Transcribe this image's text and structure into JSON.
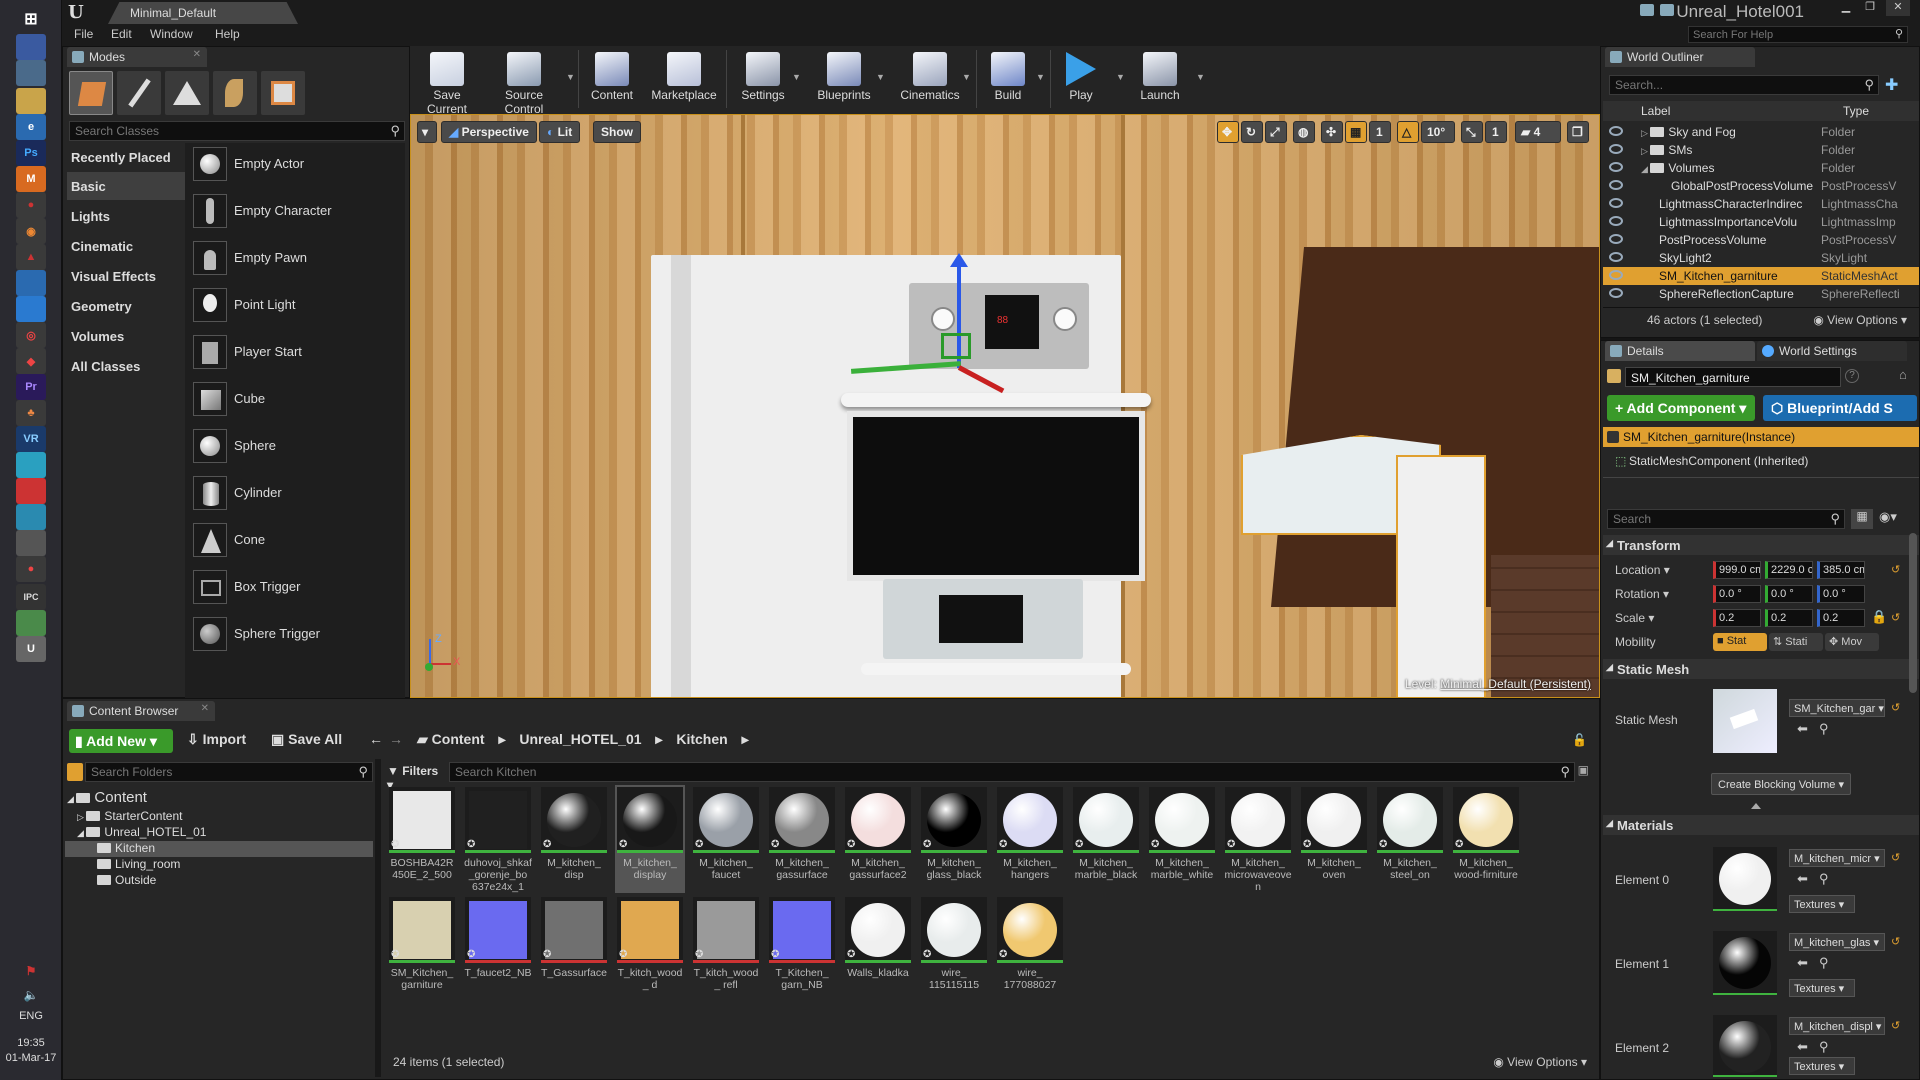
{
  "window": {
    "doc_tab": "Minimal_Default",
    "project_name": "Unreal_Hotel001",
    "help_search_placeholder": "Search For Help"
  },
  "menu": [
    "File",
    "Edit",
    "Window",
    "Help"
  ],
  "taskbar": {
    "lang": "ENG",
    "time": "19:35",
    "date": "01-Mar-17"
  },
  "modes": {
    "tab": "Modes",
    "search_placeholder": "Search Classes",
    "categories": [
      "Recently Placed",
      "Basic",
      "Lights",
      "Cinematic",
      "Visual Effects",
      "Geometry",
      "Volumes",
      "All Classes"
    ],
    "selected_category": "Basic",
    "items": [
      "Empty Actor",
      "Empty Character",
      "Empty Pawn",
      "Point Light",
      "Player Start",
      "Cube",
      "Sphere",
      "Cylinder",
      "Cone",
      "Box Trigger",
      "Sphere Trigger"
    ]
  },
  "toolbar": [
    {
      "label": "Save Current",
      "icon": "save-icon",
      "color": "#c8d0e0"
    },
    {
      "label": "Source Control",
      "icon": "source-control-icon",
      "color": "#8a9ab0"
    },
    {
      "label": "Content",
      "icon": "content-icon",
      "color": "#7a8ab8"
    },
    {
      "label": "Marketplace",
      "icon": "marketplace-icon",
      "color": "#b8c0d8"
    },
    {
      "label": "Settings",
      "icon": "gear-icon",
      "color": "#8a94a8"
    },
    {
      "label": "Blueprints",
      "icon": "blueprints-icon",
      "color": "#7a8ab8"
    },
    {
      "label": "Cinematics",
      "icon": "cinematics-icon",
      "color": "#9aa4bc"
    },
    {
      "label": "Build",
      "icon": "build-icon",
      "color": "#6e86c8"
    },
    {
      "label": "Play",
      "icon": "play-icon",
      "color": "#3aa0e8"
    },
    {
      "label": "Launch",
      "icon": "launch-icon",
      "color": "#8a94a8"
    }
  ],
  "viewport": {
    "perspective": "Perspective",
    "lit": "Lit",
    "show": "Show",
    "snap_angle": "10°",
    "camera_speed": "4",
    "grid_snap": "1",
    "scale_snap": "1",
    "level_label": "Level:",
    "level_name": "Minimal_Default (Persistent)"
  },
  "outliner": {
    "tab": "World Outliner",
    "search_placeholder": "Search...",
    "col_label": "Label",
    "col_type": "Type",
    "rows": [
      {
        "label": "Sky and Fog",
        "type": "Folder"
      },
      {
        "label": "SMs",
        "type": "Folder"
      },
      {
        "label": "Volumes",
        "type": "Folder"
      },
      {
        "label": "GlobalPostProcessVolume",
        "type": "PostProcessV"
      },
      {
        "label": "LightmassCharacterIndirec",
        "type": "LightmassCha"
      },
      {
        "label": "LightmassImportanceVolu",
        "type": "LightmassImp"
      },
      {
        "label": "PostProcessVolume",
        "type": "PostProcessV"
      },
      {
        "label": "SkyLight2",
        "type": "SkyLight"
      },
      {
        "label": "SM_Kitchen_garniture",
        "type": "StaticMeshAct"
      },
      {
        "label": "SphereReflectionCapture",
        "type": "SphereReflecti"
      }
    ],
    "selected_index": 8,
    "count": "46 actors (1 selected)",
    "view_options": "View Options"
  },
  "details": {
    "tab": "Details",
    "tab2": "World Settings",
    "name": "SM_Kitchen_garniture",
    "add_component": "+ Add Component",
    "blueprint": "Blueprint/Add S",
    "instance": "SM_Kitchen_garniture(Instance)",
    "component": "StaticMeshComponent (Inherited)",
    "search_placeholder": "Search",
    "transform": {
      "title": "Transform",
      "location_label": "Location",
      "location": [
        "999.0 cm",
        "2229.0 c",
        "385.0 cm"
      ],
      "rotation_label": "Rotation",
      "rotation": [
        "0.0 °",
        "0.0 °",
        "0.0 °"
      ],
      "scale_label": "Scale",
      "scale": [
        "0.2",
        "0.2",
        "0.2"
      ],
      "mobility_label": "Mobility",
      "mobility": [
        "Stat",
        "Stati",
        "Mov"
      ]
    },
    "static_mesh": {
      "title": "Static Mesh",
      "label": "Static Mesh",
      "value": "SM_Kitchen_gar",
      "blocking": "Create Blocking Volume"
    },
    "materials": {
      "title": "Materials",
      "items": [
        {
          "label": "Element 0",
          "value": "M_kitchen_micr",
          "textures": "Textures",
          "ball": "#f0f0f0"
        },
        {
          "label": "Element 1",
          "value": "M_kitchen_glas",
          "textures": "Textures",
          "ball": "#050505"
        },
        {
          "label": "Element 2",
          "value": "M_kitchen_displ",
          "textures": "Textures",
          "ball": "#222222"
        }
      ]
    }
  },
  "content_browser": {
    "tab": "Content Browser",
    "add_new": "Add New",
    "import": "Import",
    "save_all": "Save All",
    "breadcrumb": [
      "Content",
      "Unreal_HOTEL_01",
      "Kitchen"
    ],
    "folder_search_placeholder": "Search Folders",
    "asset_search_placeholder": "Search Kitchen",
    "filters": "Filters",
    "tree": [
      {
        "label": "Content",
        "depth": 0
      },
      {
        "label": "StarterContent",
        "depth": 1
      },
      {
        "label": "Unreal_HOTEL_01",
        "depth": 1
      },
      {
        "label": "Kitchen",
        "depth": 2
      },
      {
        "label": "Living_room",
        "depth": 2
      },
      {
        "label": "Outside",
        "depth": 2
      }
    ],
    "assets": [
      {
        "name": "BOSHBA42R 450E_2_500",
        "kind": "tex",
        "color": "#e8e8e8"
      },
      {
        "name": "duhovoj_shkaf _gorenje_bo 637e24x_1",
        "kind": "tex",
        "color": "#202020"
      },
      {
        "name": "M_kitchen_ disp",
        "kind": "ball",
        "color": "#202020"
      },
      {
        "name": "M_kitchen_ display",
        "kind": "ball",
        "color": "#181818"
      },
      {
        "name": "M_kitchen_ faucet",
        "kind": "ball",
        "color": "#9aa0a8"
      },
      {
        "name": "M_kitchen_ gassurface",
        "kind": "ball",
        "color": "#888888"
      },
      {
        "name": "M_kitchen_ gassurface2",
        "kind": "ball",
        "color": "#f4dede"
      },
      {
        "name": "M_kitchen_ glass_black",
        "kind": "ball",
        "color": "#000000"
      },
      {
        "name": "M_kitchen_ hangers",
        "kind": "ball",
        "color": "#dcdcf4"
      },
      {
        "name": "M_kitchen_ marble_black",
        "kind": "ball",
        "color": "#e8eeee"
      },
      {
        "name": "M_kitchen_ marble_white",
        "kind": "ball",
        "color": "#eef2f0"
      },
      {
        "name": "M_kitchen_ microwaveoven",
        "kind": "ball",
        "color": "#f2f2f2"
      },
      {
        "name": "M_kitchen_ oven",
        "kind": "ball",
        "color": "#f0f0f0"
      },
      {
        "name": "M_kitchen_ steel_on",
        "kind": "ball",
        "color": "#e4ece8"
      },
      {
        "name": "M_kitchen_ wood-firniture",
        "kind": "ball",
        "color": "#f2e0b0"
      },
      {
        "name": "SM_Kitchen_ garniture",
        "kind": "mesh",
        "color": "#d8d0b0"
      },
      {
        "name": "T_faucet2_NB",
        "kind": "tex",
        "color": "#6a6af0"
      },
      {
        "name": "T_Gassurface",
        "kind": "tex",
        "color": "#707070"
      },
      {
        "name": "T_kitch_wood_ d",
        "kind": "tex",
        "color": "#e0a850"
      },
      {
        "name": "T_kitch_wood_ refl",
        "kind": "tex",
        "color": "#9a9a9a"
      },
      {
        "name": "T_Kitchen_ garn_NB",
        "kind": "tex",
        "color": "#6a6af0"
      },
      {
        "name": "Walls_kladka",
        "kind": "ball",
        "color": "#f0f0f0"
      },
      {
        "name": "wire_ 115115115",
        "kind": "ball",
        "color": "#e8ecec"
      },
      {
        "name": "wire_ 177088027",
        "kind": "ball",
        "color": "#f0c870"
      }
    ],
    "selected_asset": 3,
    "count": "24 items (1 selected)",
    "view_options": "View Options"
  }
}
